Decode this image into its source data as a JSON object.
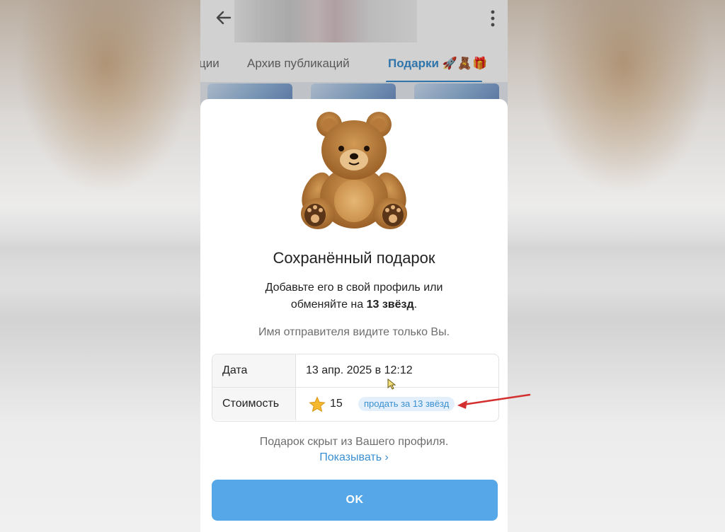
{
  "tabs": [
    {
      "label": "ции"
    },
    {
      "label": "Архив публикаций"
    },
    {
      "label": "Подарки 🚀🧸🎁"
    }
  ],
  "gift_sheet": {
    "title": "Сохранённый подарок",
    "description_line1": "Добавьте его в свой профиль или",
    "description_line2_prefix": "обменяйте на ",
    "description_line2_bold": "13 звёзд",
    "description_line2_suffix": ".",
    "sender_note": "Имя отправителя видите только Вы.",
    "details": {
      "date_label": "Дата",
      "date_value": "13 апр. 2025 в 12:12",
      "price_label": "Стоимость",
      "price_value": "15",
      "sell_chip": "продать за 13 звёзд"
    },
    "hidden_note": "Подарок скрыт из Вашего профиля.",
    "show_link": "Показывать ›",
    "ok_label": "OK"
  },
  "colors": {
    "accent": "#3a8fd1",
    "button": "#55a7e8",
    "annotation_arrow": "#d32f2f"
  }
}
